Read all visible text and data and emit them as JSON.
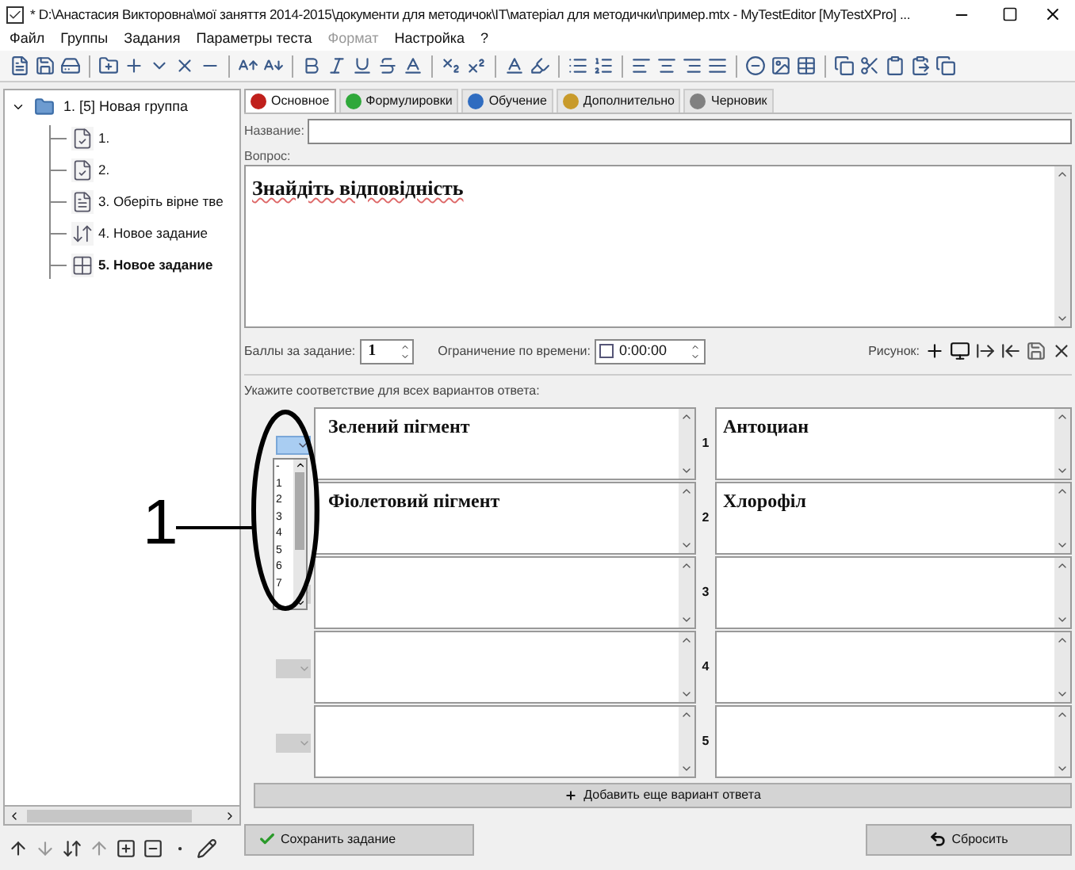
{
  "window": {
    "title": "* D:\\Анастасия Викторовна\\мої заняття 2014-2015\\документи для методичок\\IT\\матеріал для методички\\пример.mtx - MyTestEditor [MyTestXPro] ..."
  },
  "menu": [
    {
      "label": "Файл",
      "disabled": false
    },
    {
      "label": "Группы",
      "disabled": false
    },
    {
      "label": "Задания",
      "disabled": false
    },
    {
      "label": "Параметры теста",
      "disabled": false
    },
    {
      "label": "Формат",
      "disabled": true
    },
    {
      "label": "Настройка",
      "disabled": false
    },
    {
      "label": "?",
      "disabled": false
    }
  ],
  "tree": [
    {
      "label": "1. [5] Новая группа",
      "selected": false,
      "expanded": true,
      "children": [
        {
          "label": "1.",
          "kind": "check",
          "selected": false
        },
        {
          "label": "2.",
          "kind": "check",
          "selected": false
        },
        {
          "label": "3. Оберіть вірне тве",
          "kind": "single",
          "selected": false
        },
        {
          "label": "4. Новое задание",
          "kind": "order",
          "selected": false
        },
        {
          "label": "5. Новое задание",
          "kind": "match",
          "selected": true
        }
      ]
    }
  ],
  "tabs": [
    {
      "label": "Основное",
      "color": "#c0201c",
      "selected": true
    },
    {
      "label": "Формулировки",
      "color": "#2fa83a",
      "selected": false
    },
    {
      "label": "Обучение",
      "color": "#2f6cc0",
      "selected": false
    },
    {
      "label": "Дополнительно",
      "color": "#c89a2a",
      "selected": false
    },
    {
      "label": "Черновик",
      "color": "#808080",
      "selected": false
    }
  ],
  "name_field": {
    "label": "Название:"
  },
  "question": {
    "label": "Вопрос:",
    "text": "Знайдіть відповідність"
  },
  "points": {
    "label": "Баллы за задание:",
    "value": "1"
  },
  "time_limit": {
    "label": "Ограничение по времени:",
    "checked": false,
    "value": "0:00:00"
  },
  "picture": {
    "label": "Рисунок:"
  },
  "instruction": "Укажите соответствие для всех вариантов ответа:",
  "pairs": [
    {
      "kind": "open",
      "left": "Зелений пігмент",
      "number": "1",
      "right": "Антоциан"
    },
    {
      "kind": "hidden",
      "left": "Фіолетовий пігмент",
      "number": "2",
      "right": "Хлорофіл"
    },
    {
      "kind": "closed",
      "number": "3"
    },
    {
      "kind": "closed",
      "number": "4"
    },
    {
      "kind": "closed",
      "number": "5"
    }
  ],
  "dropdown_list": [
    "-",
    "1",
    "2",
    "3",
    "4",
    "5",
    "6",
    "7"
  ],
  "add_button": "Добавить еще вариант ответа",
  "save_button": "Сохранить задание",
  "reset_button": "Сбросить",
  "annotation": {
    "label": "1"
  }
}
